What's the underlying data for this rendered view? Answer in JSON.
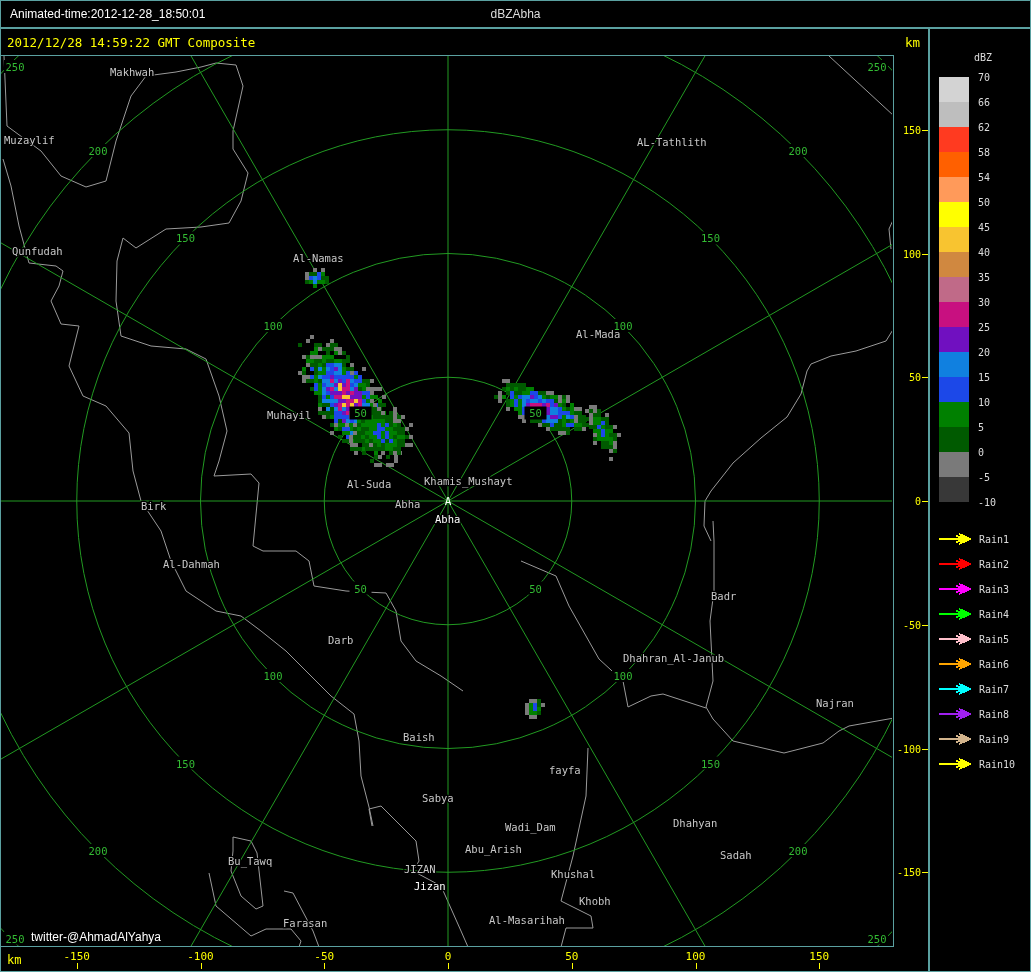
{
  "title_bar": {
    "animated_time": "Animated-time:2012-12-28_18:50:01",
    "product": "dBZAbha"
  },
  "map": {
    "timestamp": "2012/12/28 14:59:22 GMT Composite",
    "y_unit": "km",
    "rings": [
      {
        "labels": [
          "50",
          "50",
          "50",
          "50"
        ]
      },
      {
        "labels": [
          "100",
          "100",
          "100",
          "100"
        ]
      },
      {
        "labels": [
          "150",
          "150",
          "150",
          "150"
        ]
      },
      {
        "labels": [
          "200",
          "200",
          "200",
          "200"
        ]
      },
      {
        "labels": [
          "250",
          "250",
          "250",
          "250"
        ]
      }
    ],
    "places": [
      {
        "name": "Makhwah",
        "kind": "town"
      },
      {
        "name": "Muzaylif",
        "kind": "town"
      },
      {
        "name": "Qunfudah",
        "kind": "town"
      },
      {
        "name": "Al-Namas",
        "kind": "town"
      },
      {
        "name": "AL-Tathlith",
        "kind": "town"
      },
      {
        "name": "Al-Mada",
        "kind": "town"
      },
      {
        "name": "Muhayil",
        "kind": "town"
      },
      {
        "name": "Al-Suda",
        "kind": "town"
      },
      {
        "name": "Khamis_Mushayt",
        "kind": "town"
      },
      {
        "name": "Birk",
        "kind": "town"
      },
      {
        "name": "Abha",
        "kind": "town"
      },
      {
        "name": "Abha",
        "kind": "station"
      },
      {
        "name": "Al-Dahmah",
        "kind": "town"
      },
      {
        "name": "Badr",
        "kind": "town"
      },
      {
        "name": "Darb",
        "kind": "town"
      },
      {
        "name": "Dhahran_Al-Janub",
        "kind": "town"
      },
      {
        "name": "Najran",
        "kind": "town"
      },
      {
        "name": "Baish",
        "kind": "town"
      },
      {
        "name": "fayfa",
        "kind": "town"
      },
      {
        "name": "Sabya",
        "kind": "town"
      },
      {
        "name": "Dhahyan",
        "kind": "town"
      },
      {
        "name": "Wadi_Dam",
        "kind": "town"
      },
      {
        "name": "Abu_Arish",
        "kind": "town"
      },
      {
        "name": "Sadah",
        "kind": "town"
      },
      {
        "name": "Bu_Tawq",
        "kind": "town"
      },
      {
        "name": "JIZAN",
        "kind": "town"
      },
      {
        "name": "Khushal",
        "kind": "town"
      },
      {
        "name": "Jizan",
        "kind": "station"
      },
      {
        "name": "Khobh",
        "kind": "town"
      },
      {
        "name": "Farasan",
        "kind": "town"
      },
      {
        "name": "Al-Masarihah",
        "kind": "town"
      }
    ],
    "center_marker": "A",
    "credit": "twitter-@AhmadAlYahya",
    "y_ticks": [
      "150",
      "100",
      "50",
      "0",
      "-50",
      "-100",
      "-150"
    ],
    "x_unit": "km",
    "x_ticks": [
      "-150",
      "-100",
      "-50",
      "0",
      "50",
      "100",
      "150"
    ]
  },
  "legend": {
    "title": "dBZ",
    "scale": [
      {
        "color": "#d3d3d3"
      },
      {
        "color": "#bebebe"
      },
      {
        "color": "#ff3a20"
      },
      {
        "color": "#ff6000"
      },
      {
        "color": "#ff9a5a"
      },
      {
        "color": "#ffff00"
      },
      {
        "color": "#f8c430"
      },
      {
        "color": "#d08840"
      },
      {
        "color": "#c06a88"
      },
      {
        "color": "#c81080"
      },
      {
        "color": "#7010c0"
      },
      {
        "color": "#1080e0"
      },
      {
        "color": "#1c48e8"
      },
      {
        "color": "#008000"
      },
      {
        "color": "#005a00"
      },
      {
        "color": "#7a7a7a"
      },
      {
        "color": "#383838"
      }
    ],
    "scale_labels": [
      "70",
      "66",
      "62",
      "58",
      "54",
      "50",
      "45",
      "40",
      "35",
      "30",
      "25",
      "20",
      "15",
      "10",
      "5",
      "0",
      "-5",
      "-10"
    ],
    "rain_tracks": [
      {
        "label": "Rain1",
        "color": "#ffff00"
      },
      {
        "label": "Rain2",
        "color": "#ff0000"
      },
      {
        "label": "Rain3",
        "color": "#ff00ff"
      },
      {
        "label": "Rain4",
        "color": "#00ff00"
      },
      {
        "label": "Rain5",
        "color": "#ffc0cb"
      },
      {
        "label": "Rain6",
        "color": "#ffa500"
      },
      {
        "label": "Rain7",
        "color": "#00ffff"
      },
      {
        "label": "Rain8",
        "color": "#a020f0"
      },
      {
        "label": "Rain9",
        "color": "#d2b48c"
      },
      {
        "label": "Rain10",
        "color": "#ffff00"
      }
    ]
  }
}
